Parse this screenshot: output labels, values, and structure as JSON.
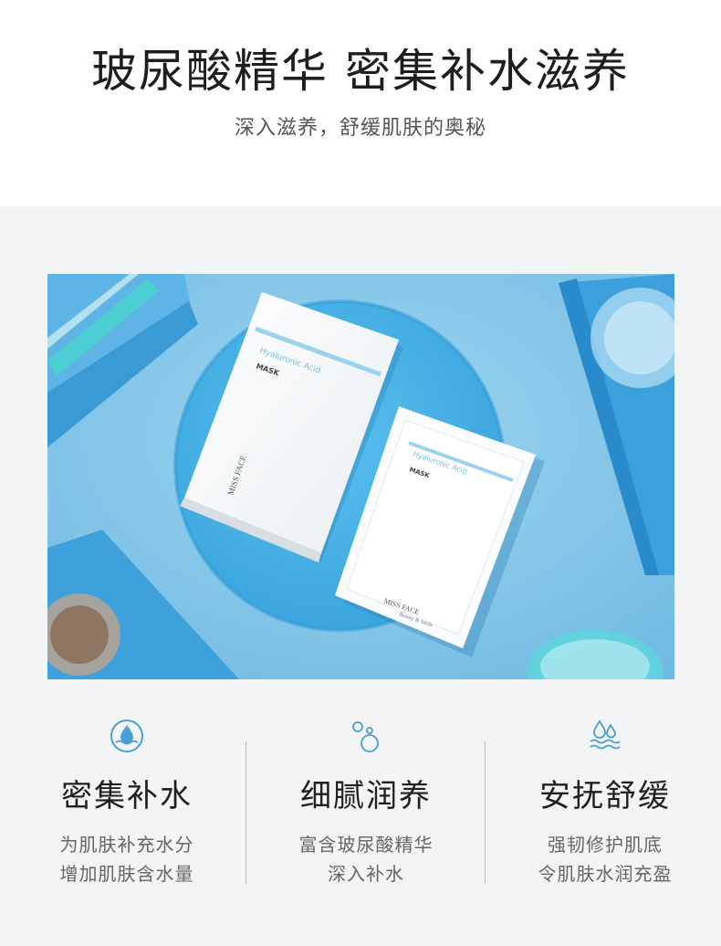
{
  "header": {
    "title": "玻尿酸精华  密集补水滋养",
    "subtitle": "深入滋养，舒缓肌肤的奥秘"
  },
  "product": {
    "label_line": "Hyaluronic Acid",
    "mask_word": "MASK",
    "brand": "MISS FACE",
    "brand_sub": "Beauty & Smile"
  },
  "features": [
    {
      "icon": "water-drop-icon",
      "name": "密集补水",
      "desc1": "为肌肤补充水分",
      "desc2": "增加肌肤含水量"
    },
    {
      "icon": "bubbles-icon",
      "name": "细腻润养",
      "desc1": "富含玻尿酸精华",
      "desc2": "深入补水"
    },
    {
      "icon": "water-waves-icon",
      "name": "安抚舒缓",
      "desc1": "强韧修护肌底",
      "desc2": "令肌肤水润充盈"
    }
  ],
  "colors": {
    "accent": "#4a9fd5",
    "photo_bg": "#88c8ea",
    "title": "#1e1e1e"
  }
}
